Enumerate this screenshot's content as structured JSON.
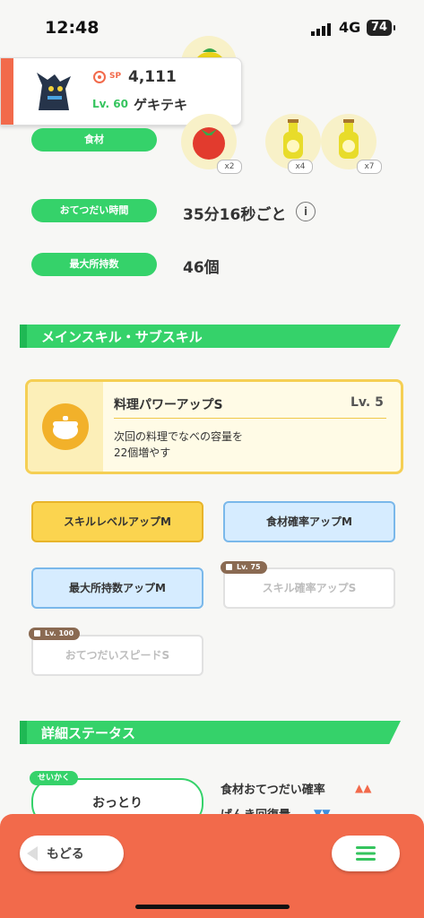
{
  "status_bar": {
    "time": "12:48",
    "network": "4G",
    "battery": "74"
  },
  "mon_card": {
    "sp_label": "SP",
    "sp_value": "4,111",
    "level": "Lv. 60",
    "name": "ゲキテキ"
  },
  "help_section": {
    "ingredients_label": "食材",
    "ingredient_quantities": [
      "x2",
      "x4",
      "x7"
    ],
    "help_time_label": "おてつだい時間",
    "help_time_value": "35分16秒ごと",
    "max_carry_label": "最大所持数",
    "max_carry_value": "46個"
  },
  "skills_section": {
    "title": "メインスキル・サブスキル",
    "main_skill": {
      "name": "料理パワーアップS",
      "level": "Lv. 5",
      "description_line1": "次回の料理でなべの容量を",
      "description_line2": "22個増やす"
    },
    "sub_skills": [
      {
        "label": "スキルレベルアップM"
      },
      {
        "label": "食材確率アップM"
      },
      {
        "label": "最大所持数アップM"
      },
      {
        "label": "スキル確率アップS",
        "lock_level": "Lv. 75"
      },
      {
        "label": "おてつだいスピードS",
        "lock_level": "Lv. 100"
      }
    ]
  },
  "detail_section": {
    "title": "詳細ステータス",
    "nature_badge": "せいかく",
    "nature_value": "おっとり",
    "stat_up": "食材おてつだい確率",
    "stat_down": "げんき回復量"
  },
  "bottom_bar": {
    "back_label": "もどる"
  },
  "colors": {
    "green": "#35d26a",
    "orange": "#f26a4b",
    "yellow": "#fbd44f",
    "blue": "#d6ecff"
  }
}
